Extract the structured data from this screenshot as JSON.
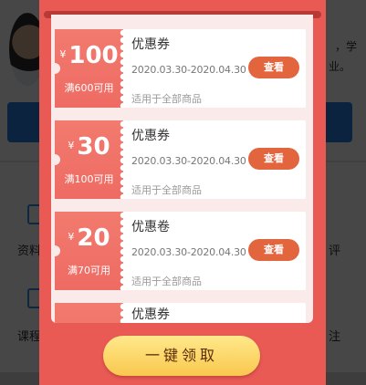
{
  "background": {
    "text_right_1": "，学",
    "text_right_2": "业。",
    "menu": [
      {
        "label": "资料",
        "icon": "document-icon"
      },
      {
        "label": "课程",
        "icon": "course-icon"
      }
    ],
    "right_fragments": [
      "评",
      "注"
    ]
  },
  "modal": {
    "coupons": [
      {
        "currency": "¥",
        "amount": "100",
        "threshold": "满600可用",
        "title": "优惠券",
        "date_range": "2020.03.30-2020.04.30",
        "scope": "适用于全部商品",
        "view_label": "查看"
      },
      {
        "currency": "¥",
        "amount": "30",
        "threshold": "满100可用",
        "title": "优惠券",
        "date_range": "2020.03.30-2020.04.30",
        "scope": "适用于全部商品",
        "view_label": "查看"
      },
      {
        "currency": "¥",
        "amount": "20",
        "threshold": "满70可用",
        "title": "优惠卷",
        "date_range": "2020.03.30-2020.04.30",
        "scope": "适用于全部商品",
        "view_label": "查看"
      },
      {
        "currency": "",
        "amount": "",
        "threshold": "",
        "title": "优惠券",
        "date_range": "",
        "scope": "",
        "view_label": ""
      }
    ],
    "claim_all_label": "一键领取"
  },
  "colors": {
    "modal_bg": "#e95a55",
    "coupon_left": "#ee6b63",
    "view_button": "#e3653e",
    "claim_button": "#f9c74e"
  }
}
